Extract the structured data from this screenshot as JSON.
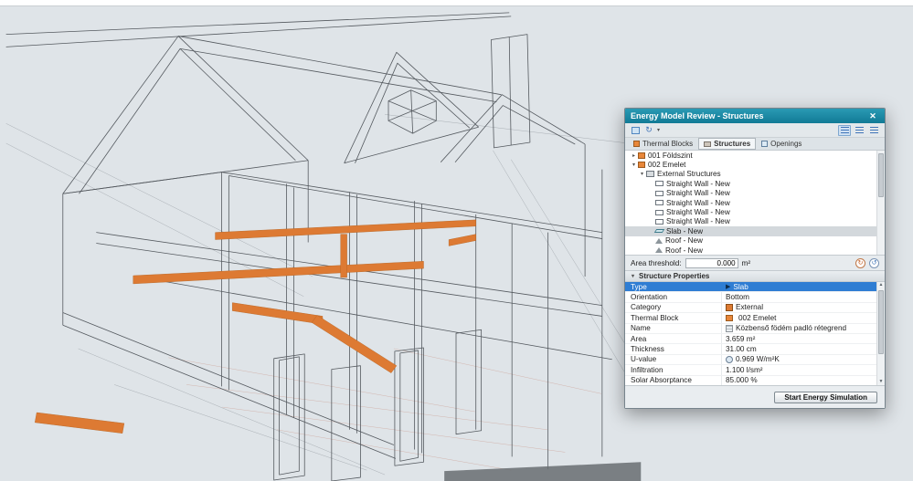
{
  "dialog": {
    "title": "Energy Model Review - Structures",
    "close_icon": "✕",
    "tabs": [
      {
        "label": "Thermal Blocks"
      },
      {
        "label": "Structures"
      },
      {
        "label": "Openings"
      }
    ],
    "tree": [
      {
        "label": "001 Földszint"
      },
      {
        "label": "002 Emelet"
      },
      {
        "label": "External Structures"
      },
      {
        "label": "Straight Wall - New"
      },
      {
        "label": "Straight Wall - New"
      },
      {
        "label": "Straight Wall - New"
      },
      {
        "label": "Straight Wall - New"
      },
      {
        "label": "Straight Wall - New"
      },
      {
        "label": "Slab - New"
      },
      {
        "label": "Roof - New"
      },
      {
        "label": "Roof - New"
      }
    ],
    "area_threshold": {
      "label": "Area threshold:",
      "value": "0.000",
      "unit": "m²"
    },
    "properties_header": "Structure Properties",
    "properties": [
      {
        "name": "Type",
        "value": "Slab"
      },
      {
        "name": "Orientation",
        "value": "Bottom"
      },
      {
        "name": "Category",
        "value": "External"
      },
      {
        "name": "Thermal Block",
        "value": "002 Emelet"
      },
      {
        "name": "Name",
        "value": "Közbenső födém padló rétegrend"
      },
      {
        "name": "Area",
        "value": "3.659 m²"
      },
      {
        "name": "Thickness",
        "value": "31.00 cm"
      },
      {
        "name": "U-value",
        "value": "0.969 W/m²K"
      },
      {
        "name": "Infiltration",
        "value": "1.100 l/sm²"
      },
      {
        "name": "Solar Absorptance",
        "value": "85.000 %"
      }
    ],
    "start_button": "Start Energy Simulation",
    "colors": {
      "accent_teal": "#117a95",
      "selection_blue": "#2f7dd3",
      "highlight_orange": "#dd7a33"
    }
  }
}
